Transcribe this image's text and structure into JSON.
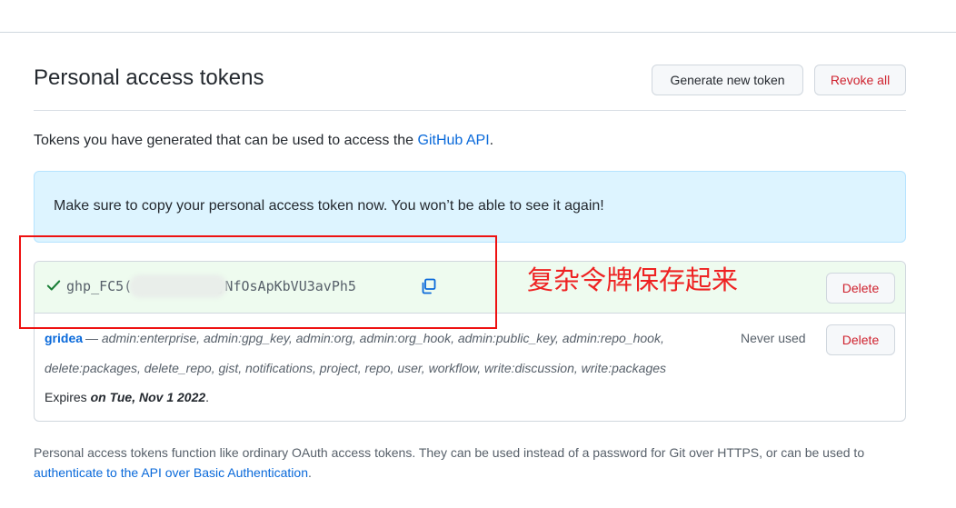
{
  "page": {
    "title": "Personal access tokens",
    "generate_label": "Generate new token",
    "revoke_label": "Revoke all"
  },
  "intro": {
    "text": "Tokens you have generated that can be used to access the ",
    "link": "GitHub API",
    "suffix": "."
  },
  "flash": {
    "message": "Make sure to copy your personal access token now. You won’t be able to see it again!"
  },
  "new_token": {
    "value_start": "ghp_FC5(",
    "value_end": "OmM6RjNfOsApKbVU3avPh5",
    "delete_label": "Delete"
  },
  "token": {
    "name": "gridea",
    "dash": " — ",
    "scopes_line1": "admin:enterprise, admin:gpg_key, admin:org, admin:org_hook, admin:public_key, admin:repo_hook,",
    "scopes_line2": "delete:packages, delete_repo, gist, notifications, project, repo, user, workflow, write:discussion, write:packages",
    "last_used": "Never used",
    "expires_prefix": "Expires ",
    "expires_date": "on Tue, Nov 1 2022",
    "expires_suffix": ".",
    "delete_label": "Delete"
  },
  "annotation": {
    "text": "复杂令牌保存起来"
  },
  "footer": {
    "text": "Personal access tokens function like ordinary OAuth access tokens. They can be used instead of a password for Git over HTTPS, or can be used to ",
    "link": "authenticate to the API over Basic Authentication",
    "suffix": "."
  },
  "colors": {
    "accent": "#0969da",
    "danger": "#cf222e",
    "success": "#1a7f37",
    "annotation": "#ee1111"
  }
}
